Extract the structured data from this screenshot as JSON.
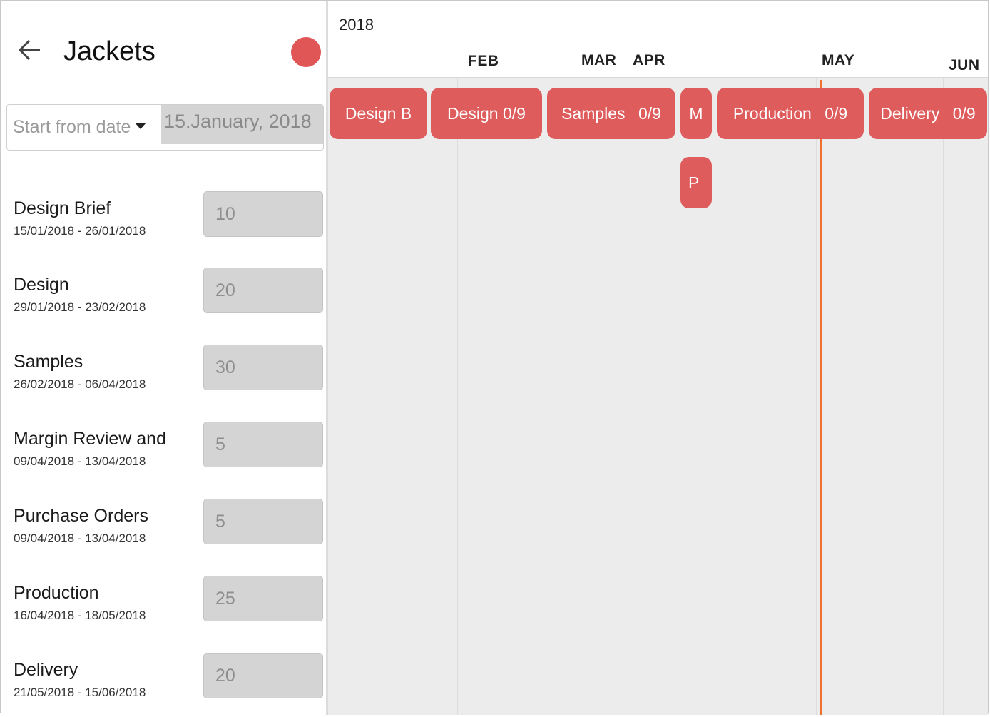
{
  "header": {
    "title": "Jackets",
    "back_icon": "arrow-left-icon",
    "status_color": "#e05555"
  },
  "date_picker": {
    "mode_label": "Start from date",
    "value": "15.January, 2018"
  },
  "phases": [
    {
      "name": "Design Brief",
      "dates": "15/01/2018 - 26/01/2018",
      "duration": "10"
    },
    {
      "name": "Design",
      "dates": "29/01/2018 - 23/02/2018",
      "duration": "20"
    },
    {
      "name": "Samples",
      "dates": "26/02/2018 - 06/04/2018",
      "duration": "30"
    },
    {
      "name": "Margin Review and",
      "dates": "09/04/2018 - 13/04/2018",
      "duration": "5"
    },
    {
      "name": "Purchase Orders",
      "dates": "09/04/2018 - 13/04/2018",
      "duration": "5"
    },
    {
      "name": "Production",
      "dates": "16/04/2018 - 18/05/2018",
      "duration": "25"
    },
    {
      "name": "Delivery",
      "dates": "21/05/2018 - 15/06/2018",
      "duration": "20"
    }
  ],
  "timeline": {
    "year": "2018",
    "months": [
      "FEB",
      "MAR",
      "APR",
      "MAY",
      "JUN"
    ],
    "bars": [
      {
        "label": "Design B",
        "progress": ""
      },
      {
        "label": "Design",
        "progress": "0/9"
      },
      {
        "label": "Samples",
        "progress": "0/9"
      },
      {
        "label": "M",
        "progress": ""
      },
      {
        "label": "Production",
        "progress": "0/9"
      },
      {
        "label": "Delivery",
        "progress": "0/9"
      },
      {
        "label": "P",
        "progress": ""
      }
    ],
    "bar_color": "#de5c5c",
    "today_color": "#f07030"
  }
}
